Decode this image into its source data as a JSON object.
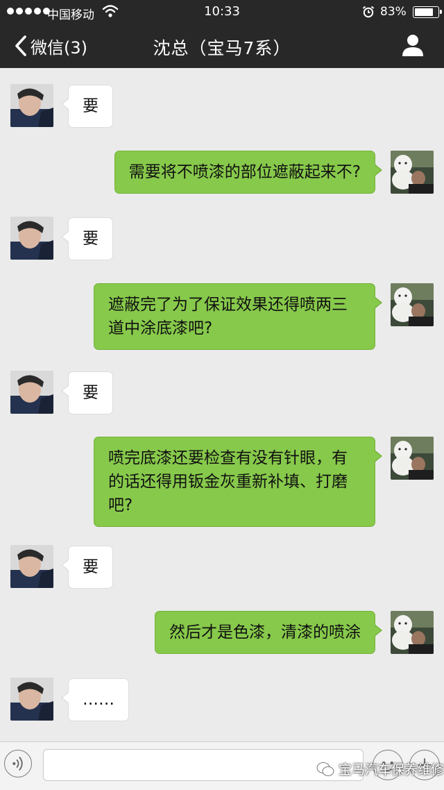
{
  "status_bar": {
    "carrier": "中国移动",
    "time": "10:33",
    "battery_percent": "83%",
    "battery_level": 0.83
  },
  "nav": {
    "back_label": "微信(3)",
    "title": "沈总（宝马7系）"
  },
  "messages": [
    {
      "side": "in",
      "text": "要"
    },
    {
      "side": "out",
      "text": "需要将不喷漆的部位遮蔽起来不?"
    },
    {
      "side": "in",
      "text": "要"
    },
    {
      "side": "out",
      "text": "遮蔽完了为了保证效果还得喷两三道中涂底漆吧?"
    },
    {
      "side": "in",
      "text": "要"
    },
    {
      "side": "out",
      "text": "喷完底漆还要检查有没有针眼，有的话还得用钣金灰重新补填、打磨吧?"
    },
    {
      "side": "in",
      "text": "要"
    },
    {
      "side": "out",
      "text": "然后才是色漆，清漆的喷涂"
    },
    {
      "side": "in",
      "text": "……"
    }
  ],
  "input_bar": {
    "text_value": "",
    "watermark": "宝马汽车保养维修"
  },
  "icons": {
    "back": "chevron-left-icon",
    "profile": "person-icon",
    "voice": "voice-icon",
    "emoji": "emoji-icon",
    "plus": "plus-icon"
  },
  "colors": {
    "nav_bg": "#282828",
    "chat_bg": "#ebebeb",
    "outgoing_bubble": "#87c94b",
    "incoming_bubble": "#ffffff"
  }
}
